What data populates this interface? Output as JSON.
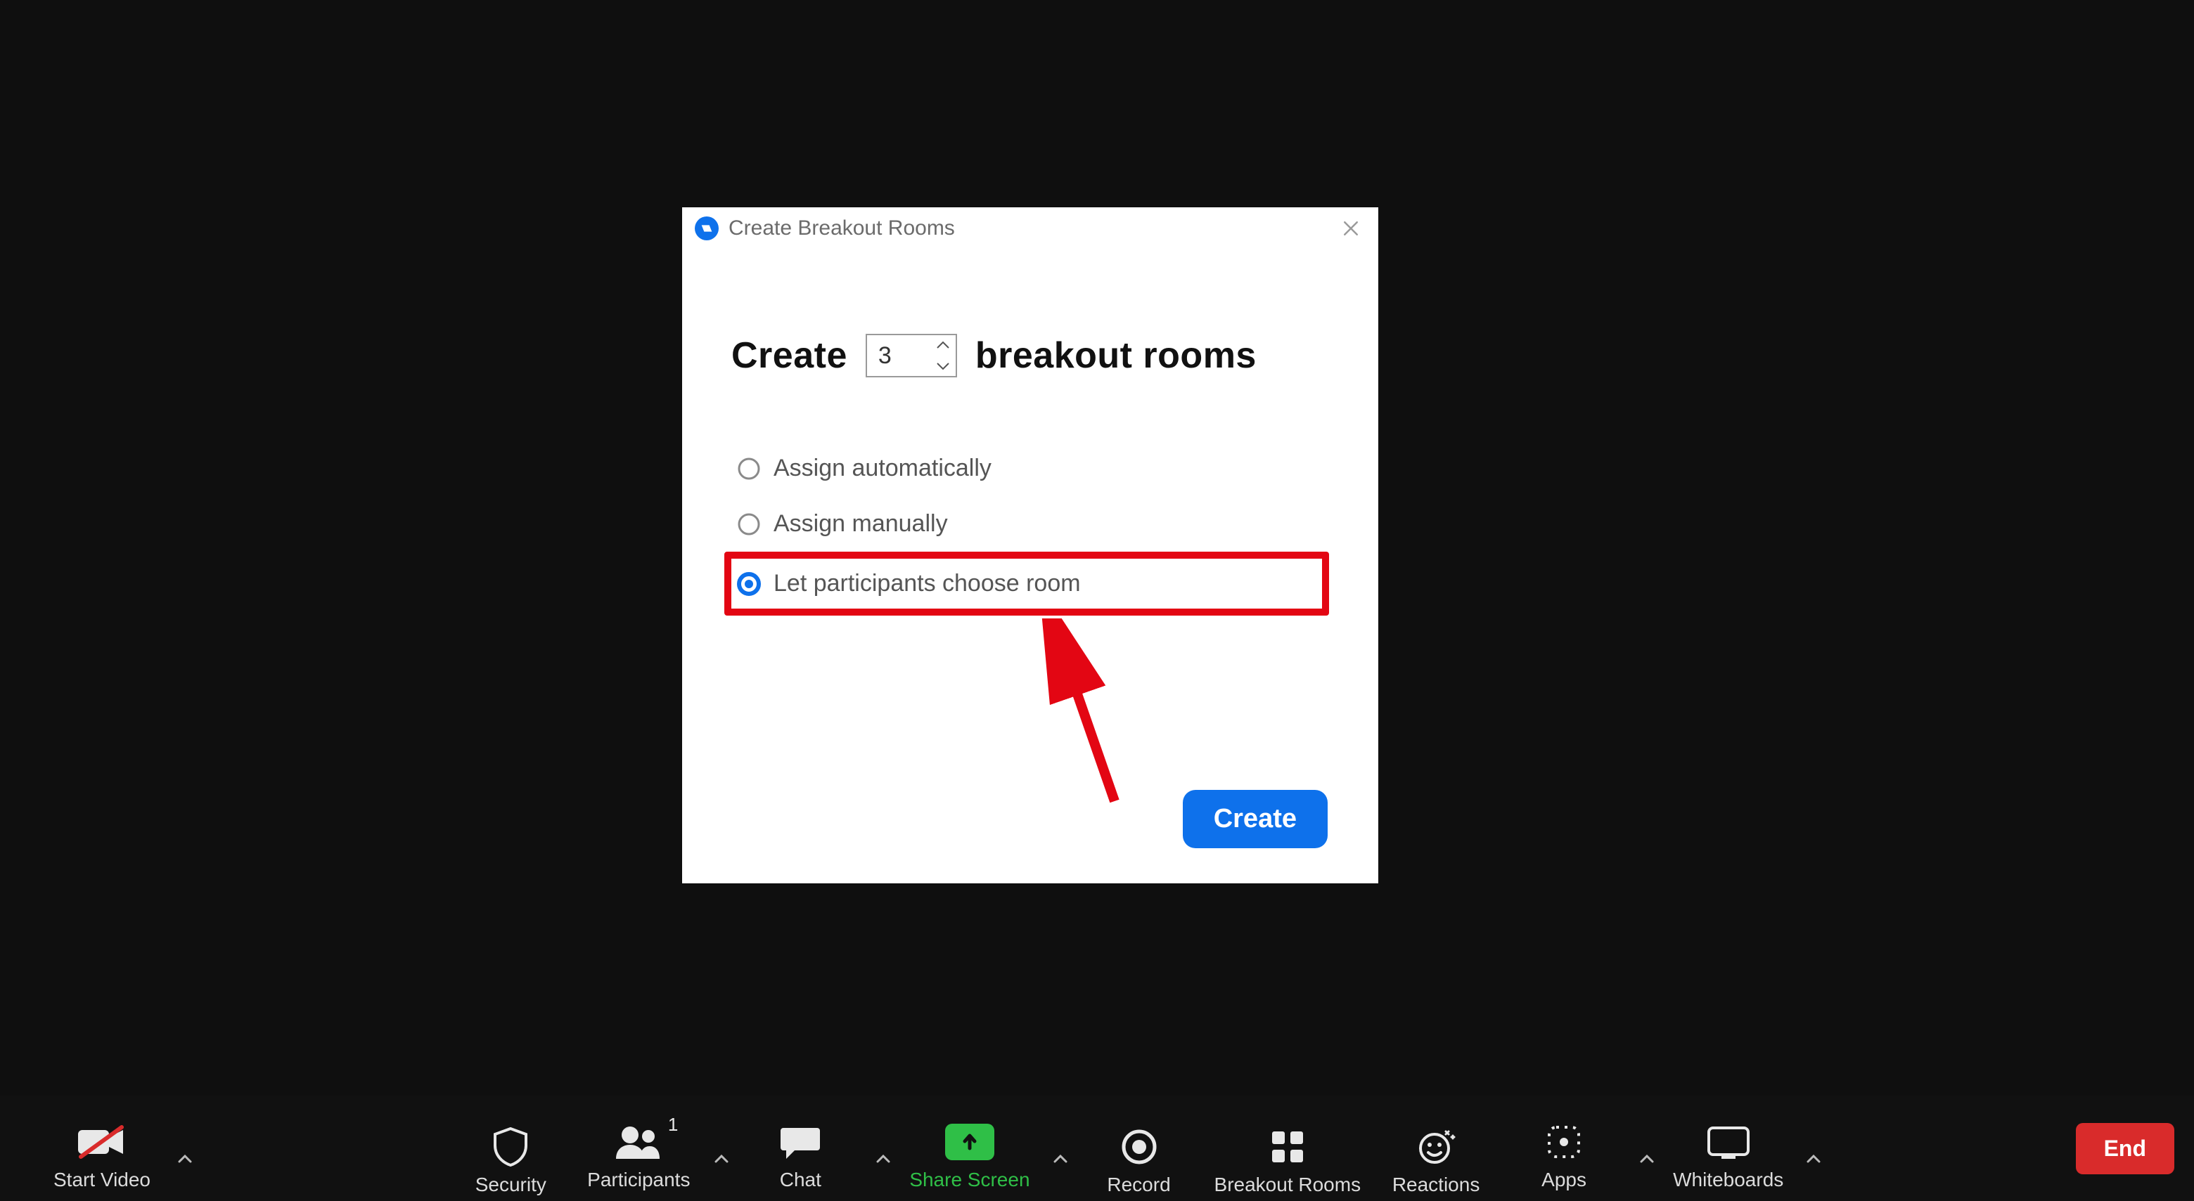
{
  "dialog": {
    "title": "Create Breakout Rooms",
    "create_prefix": "Create",
    "create_suffix": "breakout rooms",
    "room_count": "3",
    "options": {
      "auto": "Assign automatically",
      "manual": "Assign manually",
      "choose": "Let participants choose room"
    },
    "selected": "choose",
    "primary": "Create"
  },
  "toolbar": {
    "start_video": "Start Video",
    "security": "Security",
    "participants": "Participants",
    "participants_count": "1",
    "chat": "Chat",
    "share_screen": "Share Screen",
    "record": "Record",
    "breakout_rooms": "Breakout Rooms",
    "reactions": "Reactions",
    "apps": "Apps",
    "whiteboards": "Whiteboards",
    "end": "End"
  }
}
